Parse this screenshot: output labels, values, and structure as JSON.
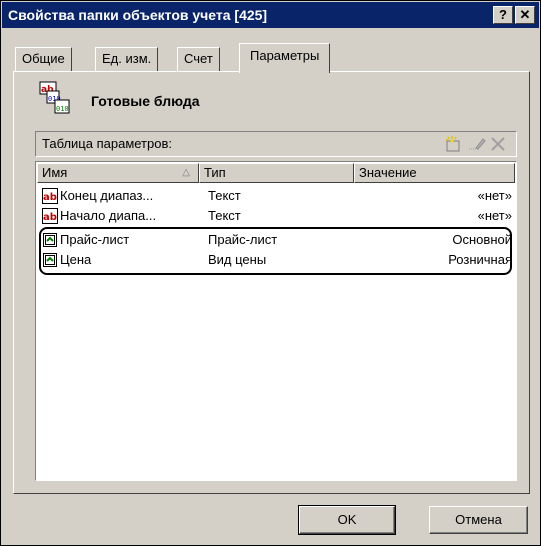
{
  "window": {
    "title": "Свойства папки объектов учета [425]",
    "help_button": "?",
    "close_button": "✕"
  },
  "tabs": [
    {
      "label": "Общие"
    },
    {
      "label": "Ед. изм."
    },
    {
      "label": "Счет"
    },
    {
      "label": "Параметры"
    }
  ],
  "category": {
    "title": "Готовые блюда"
  },
  "params": {
    "label": "Таблица параметров:",
    "toolbar": [
      "new-icon",
      "edit-icon",
      "delete-icon"
    ]
  },
  "table": {
    "columns": [
      "Имя",
      "Тип",
      "Значение"
    ],
    "rows": [
      {
        "name": "Конец диапаз...",
        "type": "Текст",
        "value": "«нет»",
        "icon": "text-field-icon"
      },
      {
        "name": "Начало диапа...",
        "type": "Текст",
        "value": "«нет»",
        "icon": "text-field-icon"
      },
      {
        "name": "Прайс-лист",
        "type": "Прайс-лист",
        "value": "Основной",
        "icon": "reference-icon"
      },
      {
        "name": "Цена",
        "type": "Вид цены",
        "value": "Розничная",
        "icon": "reference-icon"
      }
    ]
  },
  "buttons": {
    "ok": "OK",
    "cancel": "Отмена"
  },
  "colors": {
    "titlebar": "#0a246a",
    "face": "#d4d0c8"
  }
}
